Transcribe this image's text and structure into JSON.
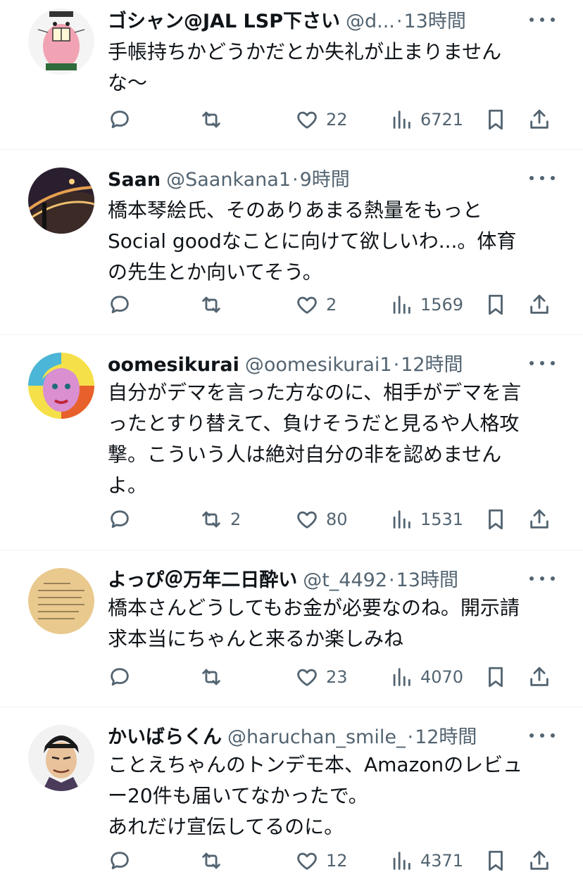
{
  "tweets": [
    {
      "name": "ゴシャン@JAL LSP下さい",
      "handle": "@d...",
      "time": "13時間",
      "text": "手帳持ちかどうかだとか失礼が止まりません\nな〜",
      "replies": "",
      "retweets": "",
      "likes": "22",
      "views": "6721",
      "avatar": "pink-cartoon-character-avatar"
    },
    {
      "name": "Saan",
      "handle": "@Saankana1",
      "time": "9時間",
      "text": "橋本琴絵氏、そのありあまる熱量をもっと\nSocial goodなことに向けて欲しいわ...。体育\nの先生とか向いてそう。",
      "replies": "",
      "retweets": "",
      "likes": "2",
      "views": "1569",
      "avatar": "night-highway-photo-avatar"
    },
    {
      "name": "oomesikurai",
      "handle": "@oomesikurai1",
      "time": "12時間",
      "text": "自分がデマを言った方なのに、相手がデマを言\nったとすり替えて、負けそうだと見るや人格攻\n撃。こういう人は絶対自分の非を認めません\nよ。",
      "replies": "",
      "retweets": "2",
      "likes": "80",
      "views": "1531",
      "avatar": "pop-art-portrait-avatar"
    },
    {
      "name": "よっぴ＠万年二日酔い",
      "handle": "@t_4492",
      "time": "13時間",
      "text": "橋本さんどうしてもお金が必要なのね。開示請\n求本当にちゃんと来るか楽しみね",
      "replies": "",
      "retweets": "",
      "likes": "23",
      "views": "4070",
      "avatar": "handwritten-document-avatar"
    },
    {
      "name": "かいばらくん",
      "handle": "@haruchan_smile_",
      "time": "12時間",
      "text": "ことえちゃんのトンデモ本、Amazonのレビュ\nー20件も届いてなかったで。\nあれだけ宣伝してるのに。",
      "replies": "",
      "retweets": "",
      "likes": "12",
      "views": "4371",
      "avatar": "manga-character-avatar"
    }
  ],
  "separator": "·",
  "colors": {
    "text": "#0f1419",
    "secondary": "#536471",
    "divider": "#eff3f4"
  }
}
